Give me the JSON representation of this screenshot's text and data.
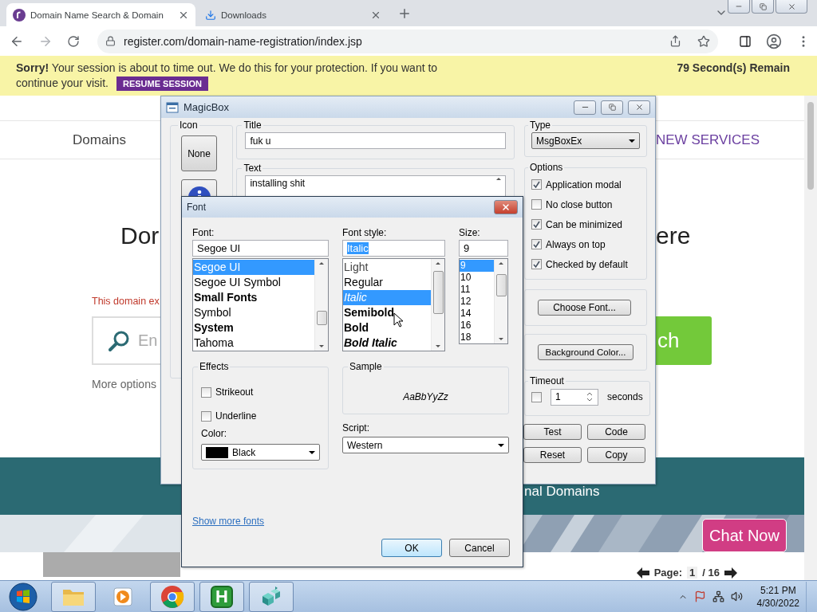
{
  "browser": {
    "tabs": [
      {
        "title": "Domain Name Search & Domain",
        "kind": "site",
        "selected": true
      },
      {
        "title": "Downloads",
        "kind": "download",
        "selected": false
      }
    ],
    "url": "register.com/domain-name-registration/index.jsp"
  },
  "banner": {
    "message_lines": [
      "**Sorry!** Your session is about to time out. We do this for your protection. If you want to",
      "continue your visit."
    ],
    "button": "RESUME SESSION",
    "countdown": "79 Second(s) Remain"
  },
  "page": {
    "nav": [
      "Domains",
      "NEW SERVICES"
    ],
    "heading": [
      "Dor",
      "ere"
    ],
    "notice": "This domain ex",
    "search": {
      "placeholder": "En",
      "button": "ch"
    },
    "more_options": "More options",
    "band_text": "nal Domains",
    "chat_button": "Chat Now",
    "pager": {
      "label": "Page:",
      "current": "1",
      "total": "/ 16"
    }
  },
  "magicbox": {
    "title": "MagicBox",
    "icon_label": "Icon",
    "icons": [
      {
        "kind": "none",
        "label": "None"
      },
      {
        "kind": "info"
      }
    ],
    "title_label": "Title",
    "title_value": "fuk u",
    "text_label": "Text",
    "text_value": "installing shit",
    "type_label": "Type",
    "type_value": "MsgBoxEx",
    "options_label": "Options",
    "options": [
      {
        "label": "Application modal",
        "checked": true
      },
      {
        "label": "No close button",
        "checked": false
      },
      {
        "label": "Can be minimized",
        "checked": true
      },
      {
        "label": "Always on top",
        "checked": true
      },
      {
        "label": "Checked by default",
        "checked": true
      }
    ],
    "choose_font": "Choose Font...",
    "background_color": "Background Color...",
    "timeout": {
      "label": "Timeout",
      "checked": false,
      "value": "1",
      "unit": "seconds"
    },
    "actions": [
      "Test",
      "Code",
      "Reset",
      "Copy"
    ]
  },
  "font_dialog": {
    "title": "Font",
    "font_label": "Font:",
    "font_value": "Segoe UI",
    "fonts": [
      {
        "name": "Segoe UI",
        "kind": "regular",
        "selected": true
      },
      {
        "name": "Segoe UI Symbol",
        "kind": "regular",
        "selected": false
      },
      {
        "name": "Small Fonts",
        "kind": "bold",
        "selected": false
      },
      {
        "name": "Symbol",
        "kind": "regular",
        "selected": false
      },
      {
        "name": "System",
        "kind": "bold",
        "selected": false
      },
      {
        "name": "Tahoma",
        "kind": "regular",
        "selected": false
      }
    ],
    "style_label": "Font style:",
    "style_value": "Italic",
    "styles": [
      {
        "name": "Light",
        "kind": "light",
        "selected": false
      },
      {
        "name": "Regular",
        "kind": "regular",
        "selected": false
      },
      {
        "name": "Italic",
        "kind": "italic",
        "selected": true
      },
      {
        "name": "Semibold",
        "kind": "semibold",
        "selected": false
      },
      {
        "name": "Bold",
        "kind": "bold",
        "selected": false
      },
      {
        "name": "Bold Italic",
        "kind": "boldital",
        "selected": false
      }
    ],
    "size_label": "Size:",
    "size_value": "9",
    "sizes": [
      {
        "name": "9",
        "selected": true
      },
      {
        "name": "10",
        "selected": false
      },
      {
        "name": "11",
        "selected": false
      },
      {
        "name": "12",
        "selected": false
      },
      {
        "name": "14",
        "selected": false
      },
      {
        "name": "16",
        "selected": false
      },
      {
        "name": "18",
        "selected": false
      }
    ],
    "effects_label": "Effects",
    "effects": [
      {
        "label": "Strikeout",
        "checked": false
      },
      {
        "label": "Underline",
        "checked": false
      }
    ],
    "color_label": "Color:",
    "color_value": "Black",
    "sample_label": "Sample",
    "sample_text": "AaBbYyZz",
    "script_label": "Script:",
    "script_value": "Western",
    "more_fonts_link": "Show more fonts",
    "buttons": [
      {
        "label": "OK",
        "kind": "default"
      },
      {
        "label": "Cancel",
        "kind": "normal"
      }
    ]
  },
  "taskbar": {
    "apps": [
      {
        "kind": "explorer"
      },
      {
        "kind": "media"
      },
      {
        "kind": "browser"
      },
      {
        "kind": "letter",
        "label": "H"
      },
      {
        "kind": "cubes"
      }
    ],
    "clock": {
      "time": "5:21 PM",
      "date": "4/30/2022"
    }
  }
}
